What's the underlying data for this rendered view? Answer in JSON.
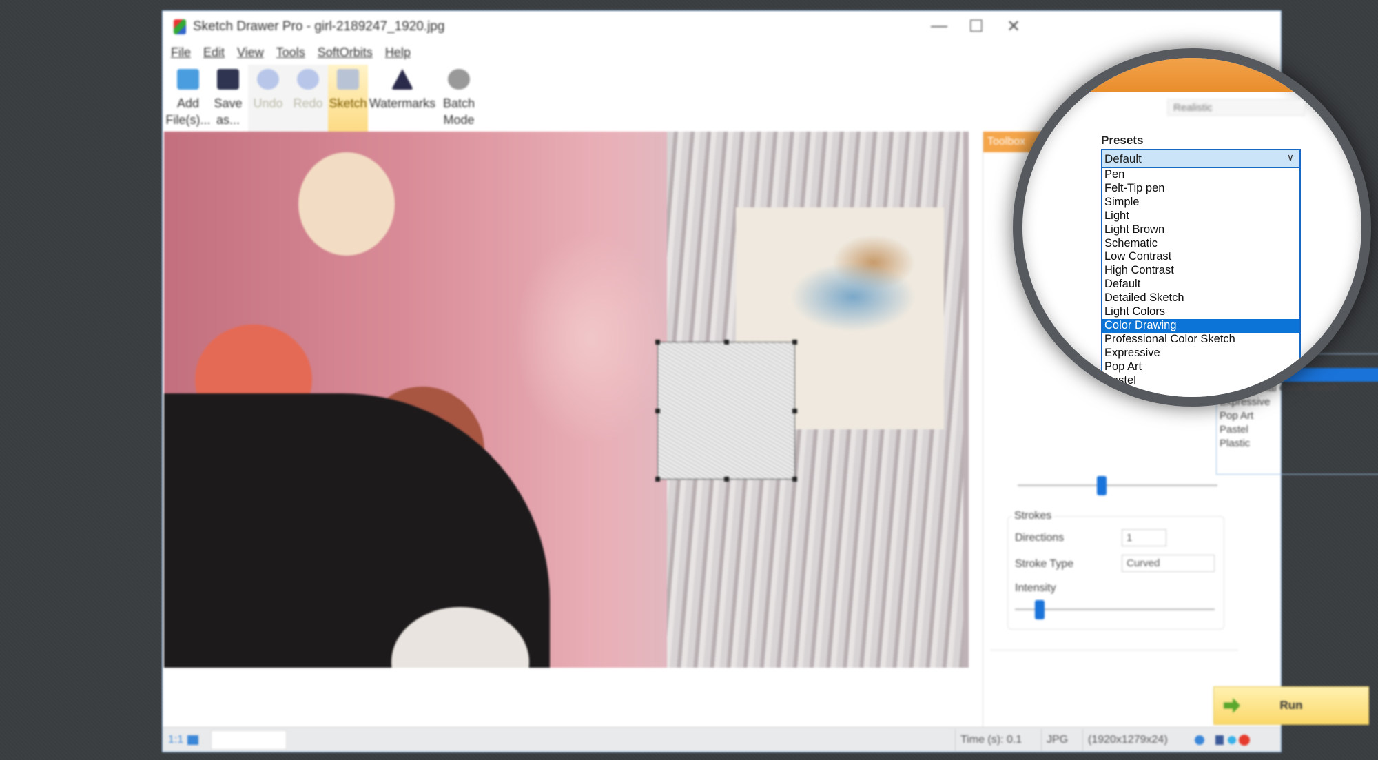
{
  "window": {
    "title": "Sketch Drawer Pro - girl-2189247_1920.jpg",
    "controls": [
      "—",
      "☐",
      "✕"
    ]
  },
  "menu": [
    "File",
    "Edit",
    "View",
    "Tools",
    "SoftOrbits",
    "Help"
  ],
  "toolbar": [
    {
      "label": "Add File(s)...",
      "icon": "folder-open-icon",
      "state": "normal"
    },
    {
      "label": "Save as...",
      "icon": "save-icon",
      "state": "normal"
    },
    {
      "label": "Undo",
      "icon": "undo-icon",
      "state": "disabled"
    },
    {
      "label": "Redo",
      "icon": "redo-icon",
      "state": "disabled"
    },
    {
      "label": "Sketch",
      "icon": "sketch-icon",
      "state": "active"
    },
    {
      "label": "Watermarks",
      "icon": "watermark-icon",
      "state": "normal"
    },
    {
      "label": "Batch Mode",
      "icon": "gear-icon",
      "state": "normal"
    }
  ],
  "panel": {
    "header": "Toolbox",
    "style_value": "Realistic",
    "behind_list": [
      "Light Colors",
      "Color Drawing",
      "Professional Color Sketch",
      "Expressive",
      "Pop Art",
      "Pastel",
      "Plastic"
    ],
    "behind_selected": "Color Drawing",
    "strokes": {
      "title": "Strokes",
      "directions_label": "Directions",
      "directions_value": "1",
      "stroke_type_label": "Stroke Type",
      "stroke_type_value": "Curved",
      "intensity_label": "Intensity",
      "intensity_level": 0.1
    },
    "run_label": "Run"
  },
  "magnifier": {
    "presets_label": "Presets",
    "selected": "Default",
    "options": [
      "Pen",
      "Felt-Tip pen",
      "Simple",
      "Light",
      "Light Brown",
      "Schematic",
      "Low Contrast",
      "High Contrast",
      "Default",
      "Detailed Sketch",
      "Light Colors",
      "Color Drawing",
      "Professional Color Sketch",
      "Expressive",
      "Pop Art",
      "Pastel",
      "Plastic"
    ],
    "highlighted": "Color Drawing"
  },
  "status": {
    "time": "Time (s): 0.1",
    "format": "JPG",
    "dims": "(1920x1279x24)"
  },
  "colors": {
    "accent": "#0b74d6",
    "toolbox_header": "#f5a54a",
    "run_button": "#fbd86a"
  }
}
